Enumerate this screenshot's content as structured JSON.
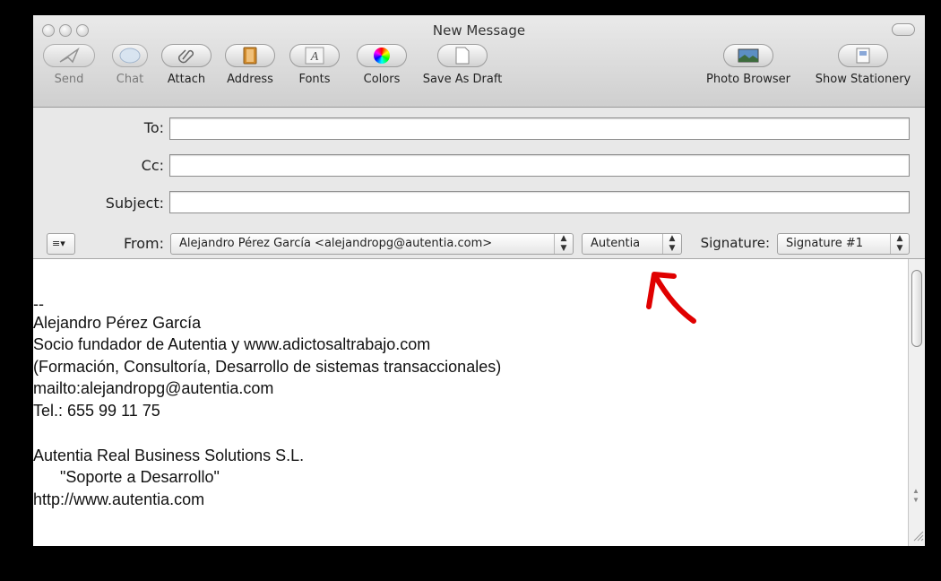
{
  "window": {
    "title": "New Message"
  },
  "toolbar": {
    "send": "Send",
    "chat": "Chat",
    "attach": "Attach",
    "address": "Address",
    "fonts": "Fonts",
    "colors": "Colors",
    "save_as_draft": "Save As Draft",
    "photo_browser": "Photo Browser",
    "show_stationery": "Show Stationery"
  },
  "header": {
    "to_label": "To:",
    "to_value": "",
    "cc_label": "Cc:",
    "cc_value": "",
    "subject_label": "Subject:",
    "subject_value": "",
    "from_label": "From:",
    "from_value": "Alejandro Pérez García <alejandropg@autentia.com>",
    "account_value": "Autentia",
    "signature_label": "Signature:",
    "signature_value": "Signature #1"
  },
  "body_lines": [
    "--",
    "Alejandro Pérez García",
    "Socio fundador de Autentia y www.adictosaltrabajo.com",
    "(Formación, Consultoría, Desarrollo de sistemas transaccionales)",
    "mailto:alejandropg@autentia.com",
    "Tel.: 655 99 11 75",
    "",
    "Autentia Real Business Solutions S.L.",
    "      \"Soporte a Desarrollo\"",
    "http://www.autentia.com"
  ],
  "colors": {
    "annotation_arrow": "#e00000"
  }
}
